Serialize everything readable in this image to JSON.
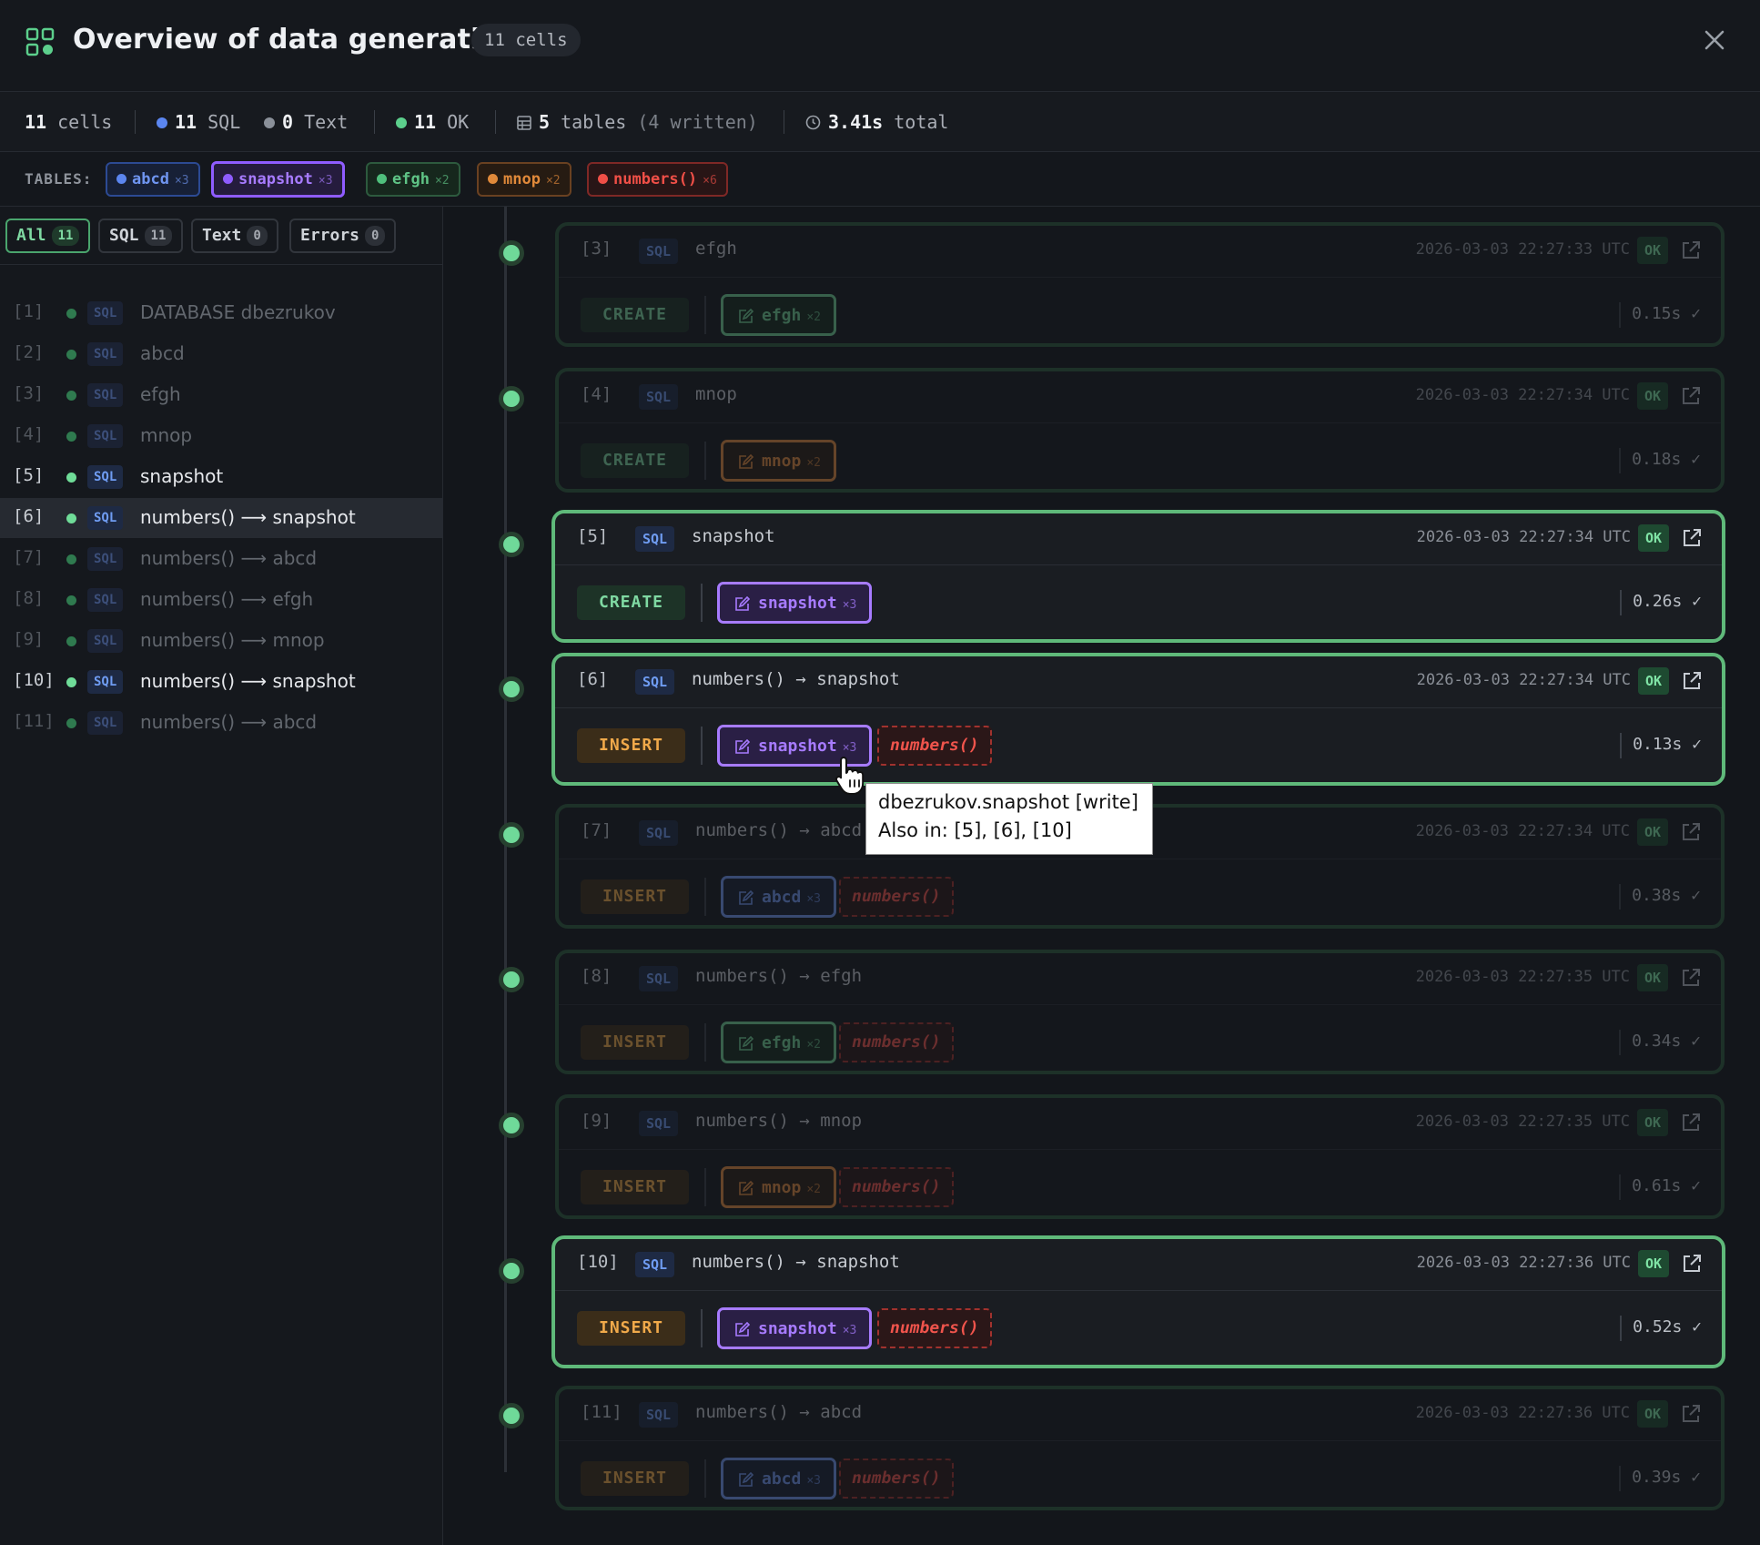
{
  "header": {
    "title": "Overview of data generation",
    "cells_badge": "11 cells",
    "icon": "grid-apps-icon",
    "close_icon": "close-icon"
  },
  "stats": {
    "cells": "11",
    "cells_label": "cells",
    "sql_count": "11",
    "sql_label": "SQL",
    "text_count": "0",
    "text_label": "Text",
    "ok_count": "11",
    "ok_label": "OK",
    "tables_count": "5",
    "tables_label": "tables",
    "tables_written": "(4 written)",
    "total_time": "3.41s",
    "total_label": "total"
  },
  "tables_bar": {
    "label": "TABLES:",
    "tables": [
      {
        "name": "abcd",
        "count": "×3",
        "color": "#5b86f0"
      },
      {
        "name": "snapshot",
        "count": "×3",
        "color": "#8f5cff"
      },
      {
        "name": "efgh",
        "count": "×2",
        "color": "#4fbf7c"
      },
      {
        "name": "mnop",
        "count": "×2",
        "color": "#e0893a"
      },
      {
        "name": "numbers()",
        "count": "×6",
        "color": "#ef4f47"
      }
    ]
  },
  "filters": [
    {
      "label": "All",
      "count": "11"
    },
    {
      "label": "SQL",
      "count": "11"
    },
    {
      "label": "Text",
      "count": "0"
    },
    {
      "label": "Errors",
      "count": "0"
    }
  ],
  "cell_list": [
    {
      "index": "[1]",
      "type": "SQL",
      "label": "DATABASE dbezrukov"
    },
    {
      "index": "[2]",
      "type": "SQL",
      "label": "abcd"
    },
    {
      "index": "[3]",
      "type": "SQL",
      "label": "efgh"
    },
    {
      "index": "[4]",
      "type": "SQL",
      "label": "mnop"
    },
    {
      "index": "[5]",
      "type": "SQL",
      "label": "snapshot"
    },
    {
      "index": "[6]",
      "type": "SQL",
      "label": "numbers() ⟶ snapshot"
    },
    {
      "index": "[7]",
      "type": "SQL",
      "label": "numbers() ⟶ abcd"
    },
    {
      "index": "[8]",
      "type": "SQL",
      "label": "numbers() ⟶ efgh"
    },
    {
      "index": "[9]",
      "type": "SQL",
      "label": "numbers() ⟶ mnop"
    },
    {
      "index": "[10]",
      "type": "SQL",
      "label": "numbers() ⟶ snapshot"
    },
    {
      "index": "[11]",
      "type": "SQL",
      "label": "numbers() ⟶ abcd"
    }
  ],
  "cards": [
    {
      "index": "[3]",
      "type": "SQL",
      "title": "efgh",
      "timestamp": "2026-03-03 22:27:33 UTC",
      "status": "OK",
      "op": "CREATE",
      "target": "efgh",
      "target_count": "×2",
      "source": "",
      "duration": "0.15s ✓"
    },
    {
      "index": "[4]",
      "type": "SQL",
      "title": "mnop",
      "timestamp": "2026-03-03 22:27:34 UTC",
      "status": "OK",
      "op": "CREATE",
      "target": "mnop",
      "target_count": "×2",
      "source": "",
      "duration": "0.18s ✓"
    },
    {
      "index": "[5]",
      "type": "SQL",
      "title": "snapshot",
      "timestamp": "2026-03-03 22:27:34 UTC",
      "status": "OK",
      "op": "CREATE",
      "target": "snapshot",
      "target_count": "×3",
      "source": "",
      "duration": "0.26s ✓"
    },
    {
      "index": "[6]",
      "type": "SQL",
      "title": "numbers() → snapshot",
      "timestamp": "2026-03-03 22:27:34 UTC",
      "status": "OK",
      "op": "INSERT",
      "target": "snapshot",
      "target_count": "×3",
      "source": "numbers()",
      "duration": "0.13s ✓"
    },
    {
      "index": "[7]",
      "type": "SQL",
      "title": "numbers() → abcd",
      "timestamp": "2026-03-03 22:27:34 UTC",
      "status": "OK",
      "op": "INSERT",
      "target": "abcd",
      "target_count": "×3",
      "source": "numbers()",
      "duration": "0.38s ✓"
    },
    {
      "index": "[8]",
      "type": "SQL",
      "title": "numbers() → efgh",
      "timestamp": "2026-03-03 22:27:35 UTC",
      "status": "OK",
      "op": "INSERT",
      "target": "efgh",
      "target_count": "×2",
      "source": "numbers()",
      "duration": "0.34s ✓"
    },
    {
      "index": "[9]",
      "type": "SQL",
      "title": "numbers() → mnop",
      "timestamp": "2026-03-03 22:27:35 UTC",
      "status": "OK",
      "op": "INSERT",
      "target": "mnop",
      "target_count": "×2",
      "source": "numbers()",
      "duration": "0.61s ✓"
    },
    {
      "index": "[10]",
      "type": "SQL",
      "title": "numbers() → snapshot",
      "timestamp": "2026-03-03 22:27:36 UTC",
      "status": "OK",
      "op": "INSERT",
      "target": "snapshot",
      "target_count": "×3",
      "source": "numbers()",
      "duration": "0.52s ✓"
    },
    {
      "index": "[11]",
      "type": "SQL",
      "title": "numbers() → abcd",
      "timestamp": "2026-03-03 22:27:36 UTC",
      "status": "OK",
      "op": "INSERT",
      "target": "abcd",
      "target_count": "×3",
      "source": "numbers()",
      "duration": "0.39s ✓"
    }
  ],
  "tooltip": {
    "line1": "dbezrukov.snapshot [write]",
    "line2": "Also in: [5], [6], [10]"
  }
}
